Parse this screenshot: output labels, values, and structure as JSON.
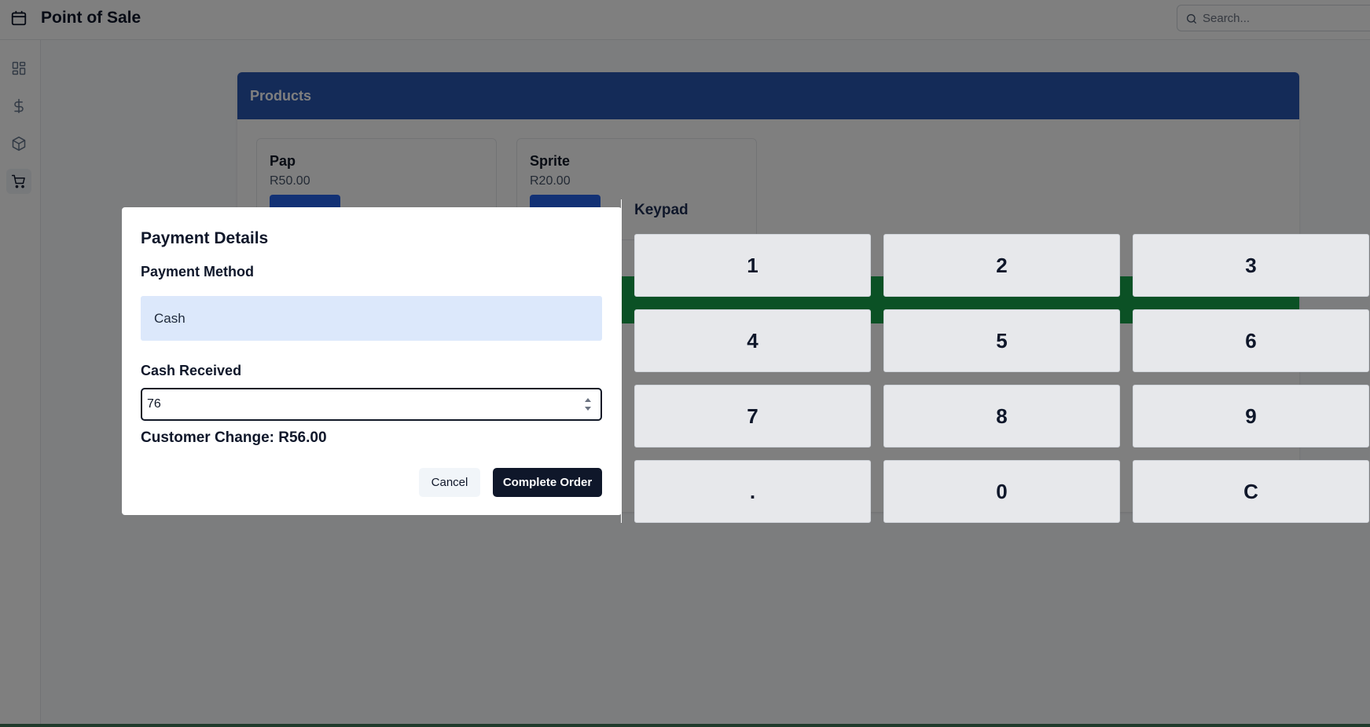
{
  "header": {
    "title": "Point of Sale",
    "search_placeholder": "Search..."
  },
  "sidebar": {
    "items": [
      {
        "icon": "dashboard-icon"
      },
      {
        "icon": "dollar-icon"
      },
      {
        "icon": "package-icon"
      },
      {
        "icon": "cart-icon",
        "active": true
      }
    ]
  },
  "products": {
    "heading": "Products",
    "items": [
      {
        "name": "Pap",
        "price": "R50.00"
      },
      {
        "name": "Sprite",
        "price": "R20.00"
      }
    ]
  },
  "payment_dialog": {
    "title": "Payment Details",
    "method_label": "Payment Method",
    "method_value": "Cash",
    "cash_label": "Cash Received",
    "cash_value": "76",
    "change_text": "Customer Change: R56.00",
    "cancel_label": "Cancel",
    "complete_label": "Complete Order"
  },
  "keypad": {
    "title": "Keypad",
    "keys": [
      "1",
      "2",
      "3",
      "4",
      "5",
      "6",
      "7",
      "8",
      "9",
      ".",
      "0",
      "C"
    ]
  },
  "colors": {
    "products_header": "#2956b0",
    "checkout_bar": "#16a34a",
    "primary_button": "#0f172a",
    "select_background": "#dce8fb",
    "remove_button": "#dc2626"
  }
}
